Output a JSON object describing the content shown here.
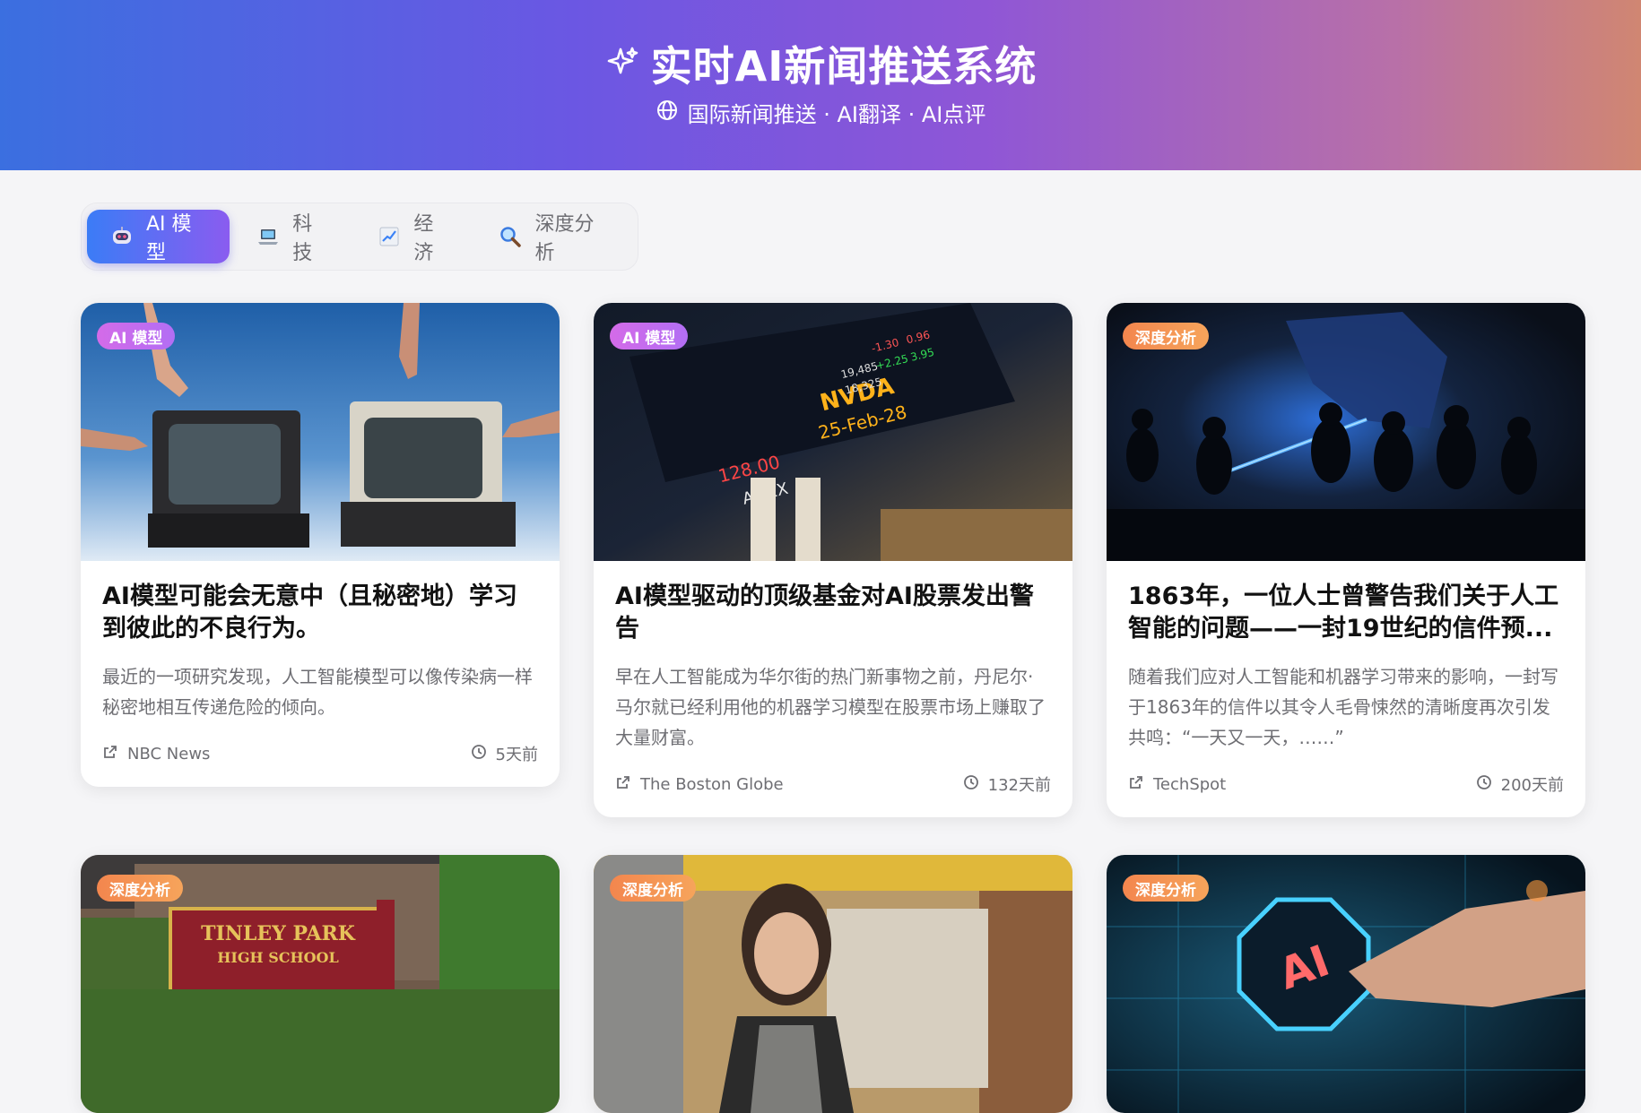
{
  "header": {
    "title": "实时AI新闻推送系统",
    "subtitle": "国际新闻推送 · AI翻译 · AI点评",
    "title_icon": "sparkles-icon",
    "subtitle_icon": "globe-icon"
  },
  "tabs": [
    {
      "label": "AI 模型",
      "icon": "robot-icon",
      "active": true
    },
    {
      "label": "科技",
      "icon": "laptop-icon",
      "active": false
    },
    {
      "label": "经济",
      "icon": "chart-icon",
      "active": false
    },
    {
      "label": "深度分析",
      "icon": "magnifier-icon",
      "active": false
    }
  ],
  "cards": [
    {
      "badge": "AI 模型",
      "title": "AI模型可能会无意中（且秘密地）学习到彼此的不良行为。",
      "summary": "最近的一项研究发现，人工智能模型可以像传染病一样秘密地相互传递危险的倾向。",
      "source": "NBC News",
      "time": "5天前"
    },
    {
      "badge": "AI 模型",
      "title": "AI模型驱动的顶级基金对AI股票发出警告",
      "summary": "早在人工智能成为华尔街的热门新事物之前，丹尼尔·马尔就已经利用他的机器学习模型在股票市场上赚取了大量财富。",
      "source": "The Boston Globe",
      "time": "132天前"
    },
    {
      "badge": "深度分析",
      "title": "1863年，一位人士曾警告我们关于人工智能的问题——一封19世纪的信件预...",
      "summary": "随着我们应对人工智能和机器学习带来的影响，一封写于1863年的信件以其令人毛骨悚然的清晰度再次引发共鸣：“一天又一天，……”",
      "source": "TechSpot",
      "time": "200天前"
    },
    {
      "badge": "深度分析"
    },
    {
      "badge": "深度分析"
    },
    {
      "badge": "深度分析"
    }
  ],
  "image_text": {
    "nvda": "NVDA",
    "date": "25-Feb-28",
    "amex": "AMEX",
    "price": "128.00",
    "school": "TINLEY PARK",
    "school2": "HIGH SCHOOL",
    "ai": "AI"
  }
}
